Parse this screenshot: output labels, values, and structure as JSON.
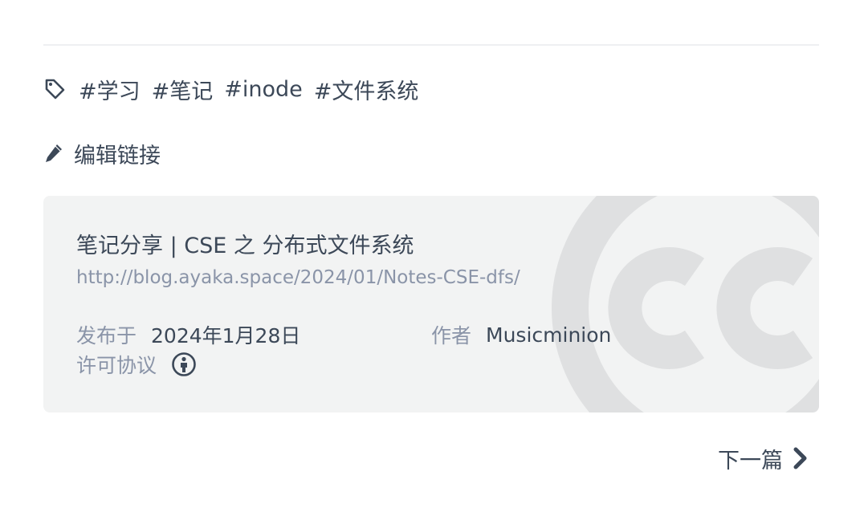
{
  "tags": {
    "icon": "tag-icon",
    "items": [
      "#学习",
      "#笔记",
      "#inode",
      "#文件系统"
    ]
  },
  "edit": {
    "icon": "pencil-icon",
    "label": "编辑链接"
  },
  "license_card": {
    "title": "笔记分享 | CSE 之 分布式文件系统",
    "url": "http://blog.ayaka.space/2024/01/Notes-CSE-dfs/",
    "published_label": "发布于",
    "published_value": "2024年1月28日",
    "author_label": "作者",
    "author_value": "Musicminion",
    "license_label": "许可协议",
    "license_icon": "cc-by-icon",
    "watermark_icon": "cc-logo-icon"
  },
  "next": {
    "label": "下一篇",
    "icon": "chevron-right-icon"
  },
  "colors": {
    "text": "#3c4858",
    "muted": "#8a94a8",
    "card_bg": "#f2f3f3",
    "watermark": "#dfe0e1"
  }
}
